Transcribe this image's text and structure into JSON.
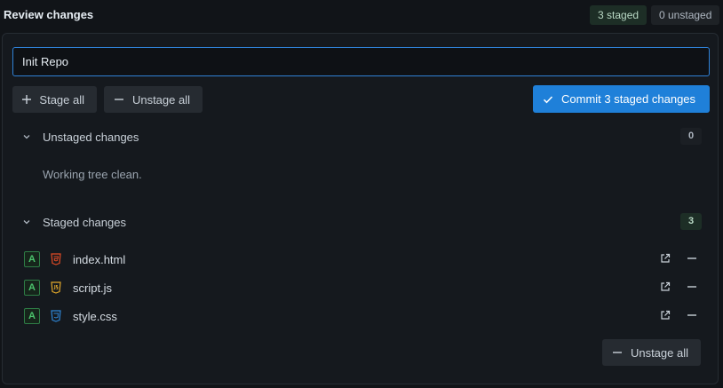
{
  "header": {
    "title": "Review changes",
    "staged_badge": "3 staged",
    "unstaged_badge": "0 unstaged"
  },
  "commit": {
    "message_value": "Init Repo",
    "commit_label": "Commit 3 staged changes"
  },
  "toolbar": {
    "stage_all_label": "Stage all",
    "unstage_all_label": "Unstage all"
  },
  "unstaged": {
    "title": "Unstaged changes",
    "count": "0",
    "empty_text": "Working tree clean."
  },
  "staged": {
    "title": "Staged changes",
    "count": "3",
    "files": [
      {
        "status": "A",
        "name": "index.html",
        "type_icon": "html5-icon",
        "icon_color": "#e34c26"
      },
      {
        "status": "A",
        "name": "script.js",
        "type_icon": "javascript-icon",
        "icon_color": "#e2a82b"
      },
      {
        "status": "A",
        "name": "style.css",
        "type_icon": "css3-icon",
        "icon_color": "#2f86d6"
      }
    ],
    "unstage_all_label": "Unstage all"
  },
  "colors": {
    "accent": "#1f80d9",
    "added_status": "#4cc46d",
    "staged_badge_bg": "#1d2e26"
  }
}
